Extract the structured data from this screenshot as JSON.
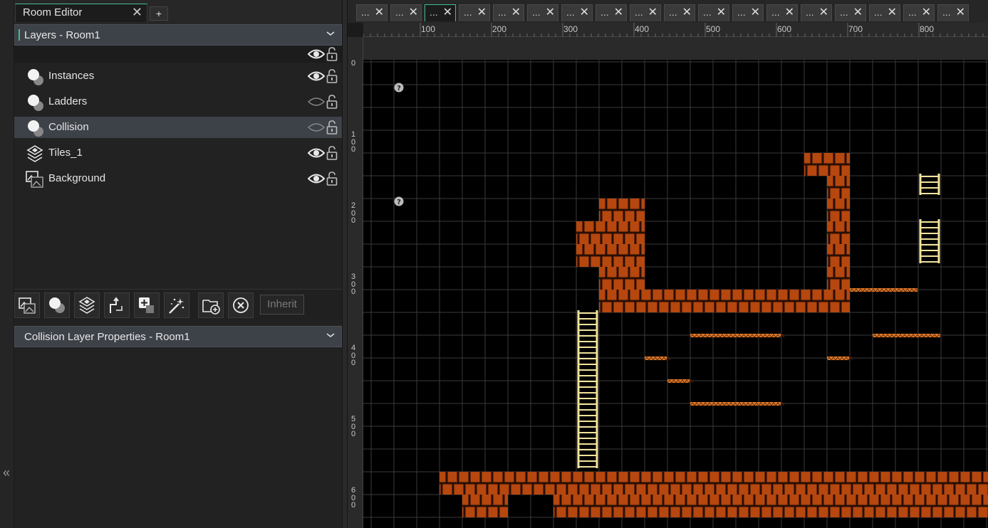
{
  "panel": {
    "tab_title": "Room Editor",
    "tab_close": "✕",
    "tab_add": "+",
    "layers_header": "Layers - Room1",
    "layers": [
      {
        "name": "Instances",
        "icon": "instance-layer-icon",
        "visible": true,
        "selected": false
      },
      {
        "name": "Ladders",
        "icon": "instance-layer-icon",
        "visible": false,
        "selected": false
      },
      {
        "name": "Collision",
        "icon": "instance-layer-icon",
        "visible": false,
        "selected": true
      },
      {
        "name": "Tiles_1",
        "icon": "tile-layer-icon",
        "visible": true,
        "selected": false
      },
      {
        "name": "Background",
        "icon": "background-layer-icon",
        "visible": true,
        "selected": false
      }
    ],
    "toolbar": {
      "buttons": [
        "add-background-layer",
        "add-instance-layer",
        "add-tile-layer",
        "add-path-layer",
        "add-asset-layer",
        "add-effect-layer",
        "add-folder",
        "delete-layer"
      ],
      "inherit_label": "Inherit"
    },
    "properties_header": "Collision Layer Properties - Room1"
  },
  "left_strip": {
    "collapse_glyph": "«"
  },
  "editor": {
    "room_tabs": [
      {
        "label": "...",
        "active": false
      },
      {
        "label": "...",
        "active": false
      },
      {
        "label": "...",
        "active": true
      },
      {
        "label": "...",
        "active": false
      },
      {
        "label": "...",
        "active": false
      },
      {
        "label": "...",
        "active": false
      },
      {
        "label": "...",
        "active": false
      },
      {
        "label": "...",
        "active": false
      },
      {
        "label": "...",
        "active": false
      },
      {
        "label": "...",
        "active": false
      },
      {
        "label": "...",
        "active": false
      },
      {
        "label": "...",
        "active": false
      },
      {
        "label": "...",
        "active": false
      },
      {
        "label": "...",
        "active": false
      },
      {
        "label": "...",
        "active": false
      },
      {
        "label": "...",
        "active": false
      },
      {
        "label": "...",
        "active": false
      },
      {
        "label": "...",
        "active": false
      }
    ],
    "ruler_top": [
      "100",
      "200",
      "300",
      "400",
      "500",
      "600",
      "700",
      "800"
    ],
    "ruler_left": [
      "0",
      "100",
      "200",
      "300",
      "400",
      "500",
      "600"
    ],
    "colors": {
      "brick": "#b5470f",
      "mortar": "#2a0f05",
      "ladder": "#f2e39a",
      "platform": "#e0782a",
      "grid": "#3a3a3a"
    }
  }
}
